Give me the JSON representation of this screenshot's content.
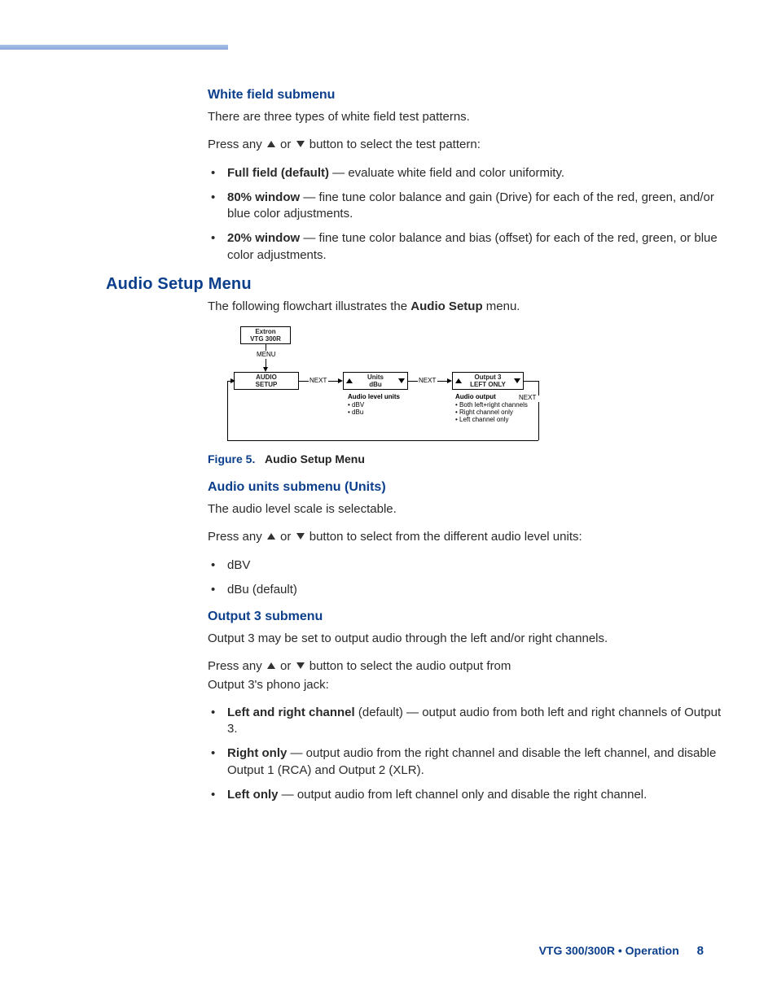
{
  "section1": {
    "heading": "White field submenu",
    "p1": "There are three types of white field test patterns.",
    "p2_pre": "Press any ",
    "p2_mid": " or ",
    "p2_post": " button to select the test pattern:",
    "bullets": [
      {
        "bold": "Full field (default)",
        "rest": " — evaluate white field and color uniformity."
      },
      {
        "bold": "80% window",
        "rest": " — fine tune color balance and gain (Drive) for each of the red, green, and/or blue color adjustments."
      },
      {
        "bold": "20% window",
        "rest": " — fine tune color balance and bias (offset) for each of the red, green, or blue color adjustments."
      }
    ]
  },
  "section2": {
    "heading": "Audio Setup Menu",
    "p1_pre": "The following flowchart illustrates the ",
    "p1_bold": "Audio Setup",
    "p1_post": " menu.",
    "figure_label": "Figure 5.",
    "figure_text": "Audio Setup Menu"
  },
  "section3": {
    "heading": "Audio units submenu (Units)",
    "p1": "The audio level scale is selectable.",
    "p2_pre": "Press any ",
    "p2_mid": " or ",
    "p2_post": " button to select from the different audio level units:",
    "bullets": [
      "dBV",
      "dBu (default)"
    ]
  },
  "section4": {
    "heading": "Output 3 submenu",
    "p1": "Output 3 may be set to output audio through the left and/or right channels.",
    "p2_pre": "Press any ",
    "p2_mid": " or ",
    "p2_post": " button to select the audio output from",
    "p2_line2": "Output 3's phono jack:",
    "bullets": [
      {
        "bold": "Left and right channel",
        "rest": " (default) — output audio from both left and right channels of Output 3."
      },
      {
        "bold": "Right only",
        "rest": " — output audio from the right channel and disable the left channel, and disable Output 1 (RCA) and Output 2 (XLR)."
      },
      {
        "bold": "Left only",
        "rest": " — output audio from left channel only and disable the right channel."
      }
    ]
  },
  "flowchart": {
    "box1": "Extron\nVTG 300R",
    "menu_label": "MENU",
    "box2": "AUDIO\nSETUP",
    "next": "NEXT",
    "box3": "Units\ndBu",
    "box4": "Output 3\nLEFT ONLY",
    "units_heading": "Audio level units",
    "units_items": [
      "dBV",
      "dBu"
    ],
    "output_heading": "Audio output",
    "output_items": [
      "Both left+right channels",
      "Right channel only",
      "Left channel only"
    ]
  },
  "footer": {
    "product": "VTG 300/300R",
    "bullet": "•",
    "section": "Operation",
    "page": "8"
  },
  "chart_data": {
    "type": "diagram",
    "note": "Menu-navigation flowchart, not a quantitative chart.",
    "nodes": [
      {
        "id": "n1",
        "label": "Extron VTG 300R",
        "kind": "title-box"
      },
      {
        "id": "n2",
        "label": "AUDIO SETUP",
        "kind": "menu-box"
      },
      {
        "id": "n3",
        "label": "Units dBu",
        "kind": "menu-box",
        "adjustable": true
      },
      {
        "id": "n4",
        "label": "Output 3 LEFT ONLY",
        "kind": "menu-box",
        "adjustable": true
      }
    ],
    "edges": [
      {
        "from": "n1",
        "to": "n2",
        "label": "MENU"
      },
      {
        "from": "n2",
        "to": "n3",
        "label": "NEXT"
      },
      {
        "from": "n3",
        "to": "n4",
        "label": "NEXT"
      },
      {
        "from": "n4",
        "to": "n2",
        "label": "NEXT",
        "loop": true
      }
    ],
    "annotations": [
      {
        "for": "n3",
        "title": "Audio level units",
        "items": [
          "dBV",
          "dBu"
        ]
      },
      {
        "for": "n4",
        "title": "Audio output",
        "items": [
          "Both left+right channels",
          "Right channel only",
          "Left channel only"
        ]
      }
    ]
  }
}
